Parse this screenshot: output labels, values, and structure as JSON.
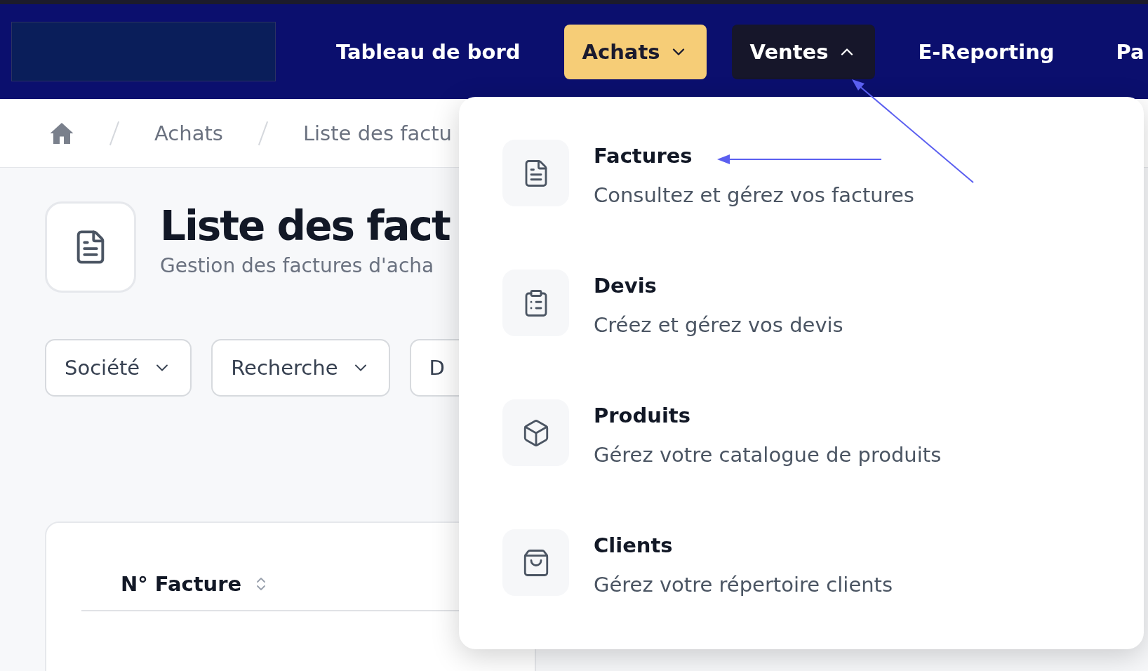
{
  "nav": {
    "items": [
      {
        "label": "Tableau de bord",
        "kind": "link",
        "selected": false,
        "expanded": false
      },
      {
        "label": "Achats",
        "kind": "menu",
        "selected": true,
        "expanded": false
      },
      {
        "label": "Ventes",
        "kind": "menu",
        "selected": false,
        "expanded": true
      },
      {
        "label": "E-Reporting",
        "kind": "link",
        "selected": false,
        "expanded": false
      },
      {
        "label": "Pa",
        "kind": "link",
        "selected": false,
        "expanded": false
      }
    ]
  },
  "breadcrumb": [
    "Achats",
    "Liste des factu"
  ],
  "page": {
    "title": "Liste des fact",
    "subtitle": "Gestion des factures d'acha"
  },
  "filters": [
    {
      "label": "Société",
      "kind": "dropdown"
    },
    {
      "label": "Recherche",
      "kind": "dropdown"
    },
    {
      "label": "D",
      "kind": "plain"
    }
  ],
  "table": {
    "columns": [
      {
        "label": "N° Facture",
        "sortable": true
      }
    ]
  },
  "menu": {
    "items": [
      {
        "title": "Factures",
        "description": "Consultez et gérez vos factures"
      },
      {
        "title": "Devis",
        "description": "Créez et gérez vos devis"
      },
      {
        "title": "Produits",
        "description": "Gérez votre catalogue de produits"
      },
      {
        "title": "Clients",
        "description": "Gérez votre répertoire clients"
      }
    ]
  }
}
